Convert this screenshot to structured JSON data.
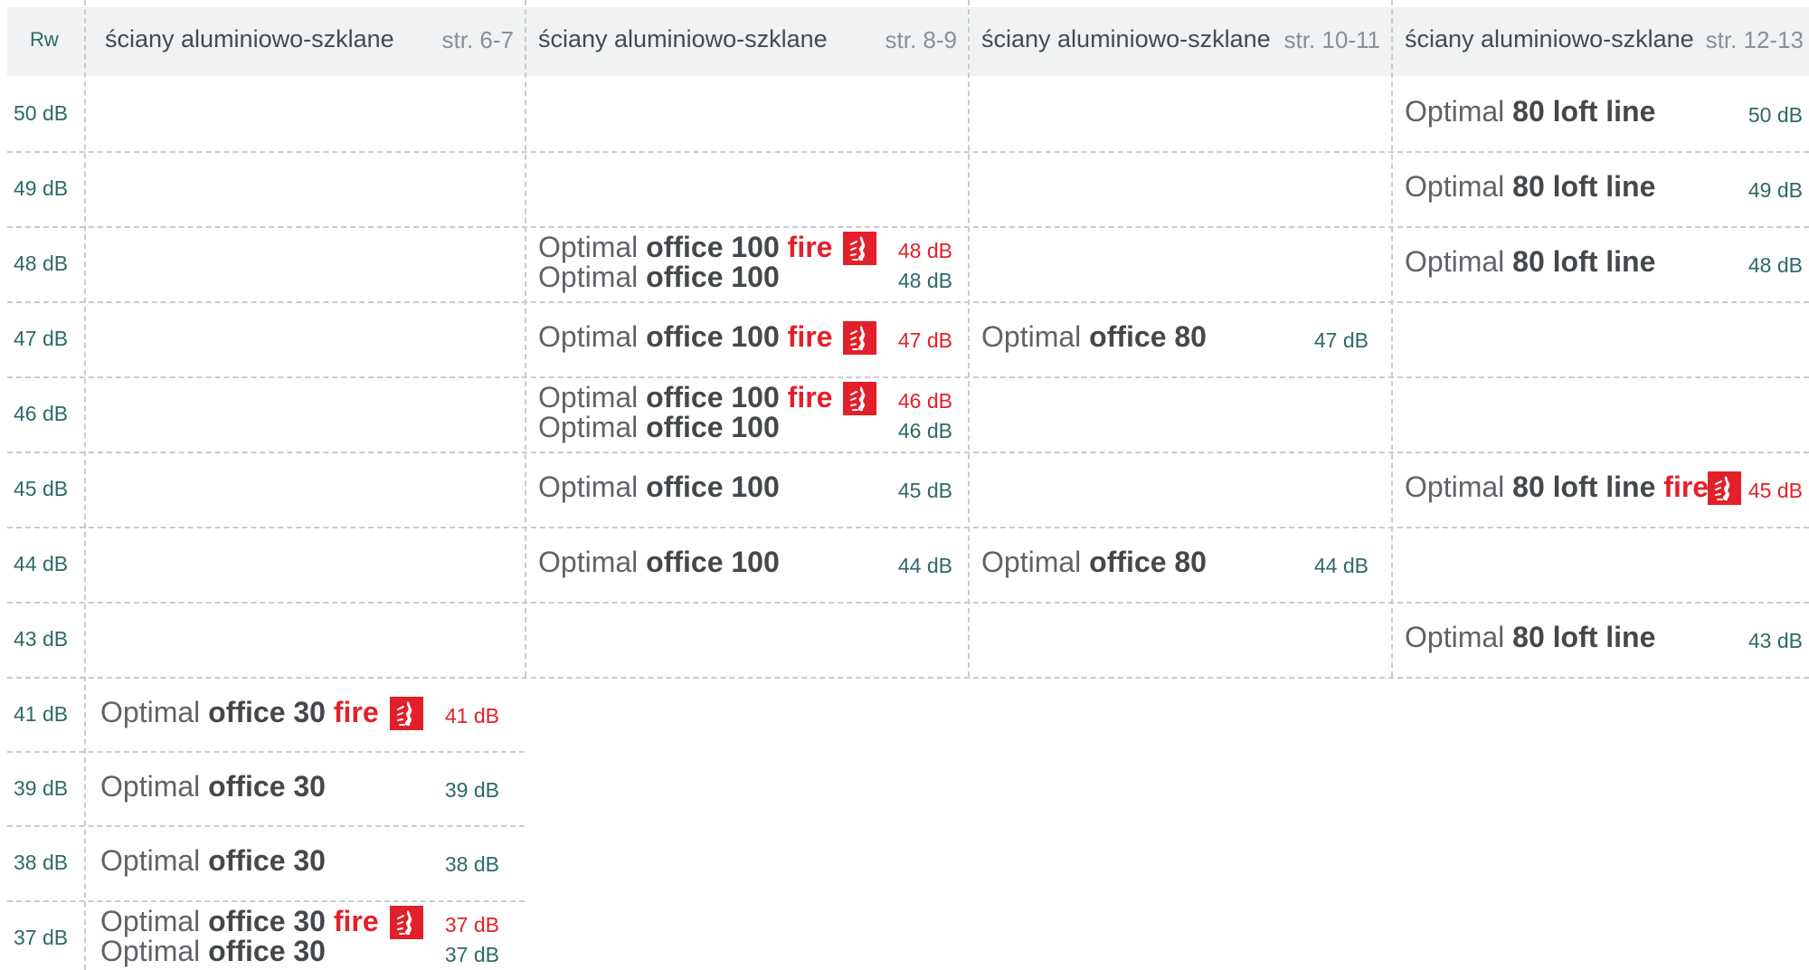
{
  "header": {
    "rw_label": "Rw",
    "columns": [
      {
        "title": "ściany aluminiowo-szklane",
        "pages": "str. 6-7"
      },
      {
        "title": "ściany aluminiowo-szklane",
        "pages": "str. 8-9"
      },
      {
        "title": "ściany aluminiowo-szklane",
        "pages": "str. 10-11"
      },
      {
        "title": "ściany aluminiowo-szklane",
        "pages": "str. 12-13"
      }
    ]
  },
  "rows": [
    {
      "rw": "50 dB",
      "entries": [
        {
          "col": 3,
          "prefix": "Optimal",
          "model": "80 loft line",
          "fire_word": "",
          "fire_icon": false,
          "db": "50 dB",
          "db_color": "green"
        }
      ]
    },
    {
      "rw": "49 dB",
      "entries": [
        {
          "col": 3,
          "prefix": "Optimal",
          "model": "80 loft line",
          "fire_word": "",
          "fire_icon": false,
          "db": "49 dB",
          "db_color": "green"
        }
      ]
    },
    {
      "rw": "48 dB",
      "entries": [
        {
          "col": 1,
          "line": 0,
          "prefix": "Optimal",
          "model": "office 100",
          "fire_word": "fire",
          "fire_icon": true,
          "db": "48 dB",
          "db_color": "red"
        },
        {
          "col": 1,
          "line": 1,
          "prefix": "Optimal",
          "model": "office 100",
          "fire_word": "",
          "fire_icon": false,
          "db": "48 dB",
          "db_color": "green"
        },
        {
          "col": 3,
          "prefix": "Optimal",
          "model": "80 loft line",
          "fire_word": "",
          "fire_icon": false,
          "db": "48 dB",
          "db_color": "green"
        }
      ]
    },
    {
      "rw": "47 dB",
      "entries": [
        {
          "col": 1,
          "prefix": "Optimal",
          "model": "office 100",
          "fire_word": "fire",
          "fire_icon": true,
          "db": "47 dB",
          "db_color": "red"
        },
        {
          "col": 2,
          "prefix": "Optimal",
          "model": "office 80",
          "fire_word": "",
          "fire_icon": false,
          "db": "47 dB",
          "db_color": "green"
        }
      ]
    },
    {
      "rw": "46 dB",
      "entries": [
        {
          "col": 1,
          "line": 0,
          "prefix": "Optimal",
          "model": "office 100",
          "fire_word": "fire",
          "fire_icon": true,
          "db": "46 dB",
          "db_color": "red"
        },
        {
          "col": 1,
          "line": 1,
          "prefix": "Optimal",
          "model": "office 100",
          "fire_word": "",
          "fire_icon": false,
          "db": "46 dB",
          "db_color": "green"
        }
      ]
    },
    {
      "rw": "45 dB",
      "entries": [
        {
          "col": 1,
          "prefix": "Optimal",
          "model": "office 100",
          "fire_word": "",
          "fire_icon": false,
          "db": "45 dB",
          "db_color": "green"
        },
        {
          "col": 3,
          "prefix": "Optimal",
          "model": "80 loft line",
          "fire_word": "fire",
          "fire_icon": true,
          "db": "45 dB",
          "db_color": "red"
        }
      ]
    },
    {
      "rw": "44 dB",
      "entries": [
        {
          "col": 1,
          "prefix": "Optimal",
          "model": "office 100",
          "fire_word": "",
          "fire_icon": false,
          "db": "44 dB",
          "db_color": "green"
        },
        {
          "col": 2,
          "prefix": "Optimal",
          "model": "office 80",
          "fire_word": "",
          "fire_icon": false,
          "db": "44 dB",
          "db_color": "green"
        }
      ]
    },
    {
      "rw": "43 dB",
      "entries": [
        {
          "col": 3,
          "prefix": "Optimal",
          "model": "80 loft line",
          "fire_word": "",
          "fire_icon": false,
          "db": "43 dB",
          "db_color": "green"
        }
      ]
    },
    {
      "rw": "41 dB",
      "entries": [
        {
          "col": 0,
          "prefix": "Optimal",
          "model": "office 30",
          "fire_word": "fire",
          "fire_icon": true,
          "db": "41 dB",
          "db_color": "red"
        }
      ]
    },
    {
      "rw": "39 dB",
      "entries": [
        {
          "col": 0,
          "prefix": "Optimal",
          "model": "office 30",
          "fire_word": "",
          "fire_icon": false,
          "db": "39 dB",
          "db_color": "green"
        }
      ]
    },
    {
      "rw": "38 dB",
      "entries": [
        {
          "col": 0,
          "prefix": "Optimal",
          "model": "office 30",
          "fire_word": "",
          "fire_icon": false,
          "db": "38 dB",
          "db_color": "green"
        }
      ]
    },
    {
      "rw": "37 dB",
      "entries": [
        {
          "col": 0,
          "line": 0,
          "prefix": "Optimal",
          "model": "office 30",
          "fire_word": "fire",
          "fire_icon": true,
          "db": "37 dB",
          "db_color": "red"
        },
        {
          "col": 0,
          "line": 1,
          "prefix": "Optimal",
          "model": "office 30",
          "fire_word": "",
          "fire_icon": false,
          "db": "37 dB",
          "db_color": "green"
        }
      ]
    }
  ],
  "colors": {
    "accent_green": "#2d6a66",
    "fire_red": "#e3202a",
    "grid": "#c9ccce",
    "header_bg": "#f1f2f3"
  }
}
